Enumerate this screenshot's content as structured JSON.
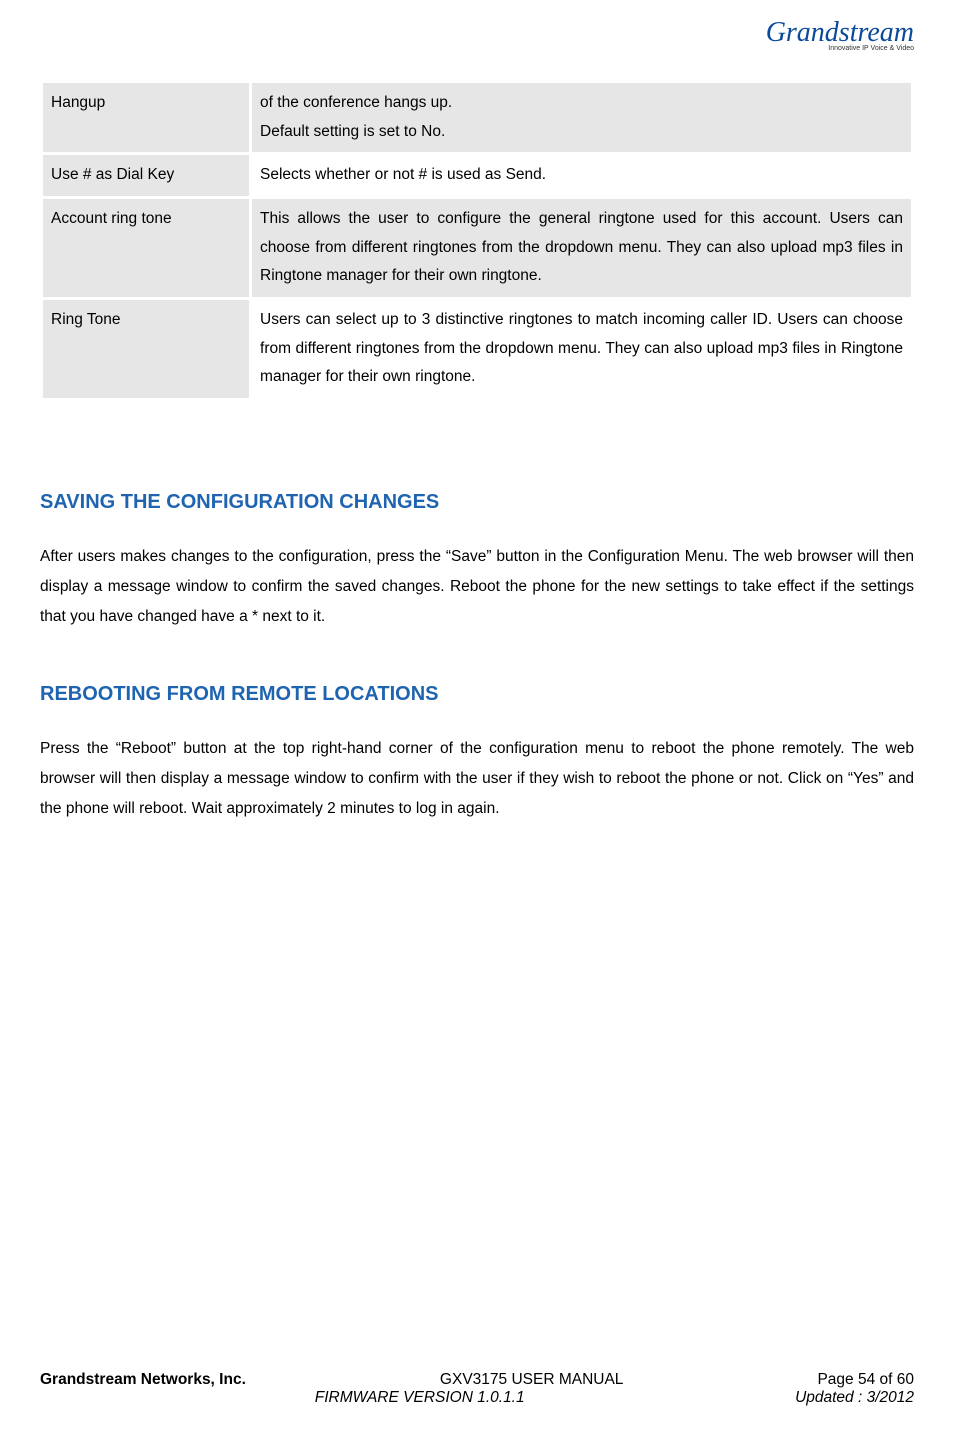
{
  "logo": {
    "brand": "Grandstream",
    "tagline": "Innovative IP Voice & Video"
  },
  "table": {
    "rows": [
      {
        "label": "Hangup",
        "desc": "of the conference hangs up.\nDefault setting is set to No."
      },
      {
        "label": "Use # as Dial Key",
        "desc": "Selects whether or not # is used as Send."
      },
      {
        "label": "Account ring tone",
        "desc": "This allows the user to configure the general ringtone used for this account. Users can choose from different ringtones from the dropdown menu. They can also upload mp3 files in Ringtone manager for their own ringtone."
      },
      {
        "label": "Ring Tone",
        "desc": "Users can select up to 3 distinctive ringtones to match incoming caller ID. Users can choose from different ringtones from the dropdown menu. They can also upload mp3 files in Ringtone manager for their own ringtone."
      }
    ]
  },
  "sections": {
    "save": {
      "heading": "SAVING THE CONFIGURATION CHANGES",
      "body": "After users makes changes to the configuration, press the “Save” button in the Configuration Menu. The web browser will then display a message window to confirm the saved changes. Reboot the phone for the new settings to take effect if the settings that you have changed have a * next to it."
    },
    "reboot": {
      "heading": "REBOOTING FROM REMOTE LOCATIONS",
      "body": "Press the “Reboot” button at the top right-hand corner of the configuration menu to reboot the phone remotely. The web browser will then display a message window to confirm with the user if they wish to reboot the phone or not. Click on “Yes” and the phone will reboot. Wait approximately 2 minutes to log in again."
    }
  },
  "footer": {
    "company": "Grandstream Networks, Inc.",
    "manual": "GXV3175 USER MANUAL",
    "page": "Page 54 of 60",
    "firmware": "FIRMWARE VERSION 1.0.1.1",
    "updated": "Updated : 3/2012"
  }
}
